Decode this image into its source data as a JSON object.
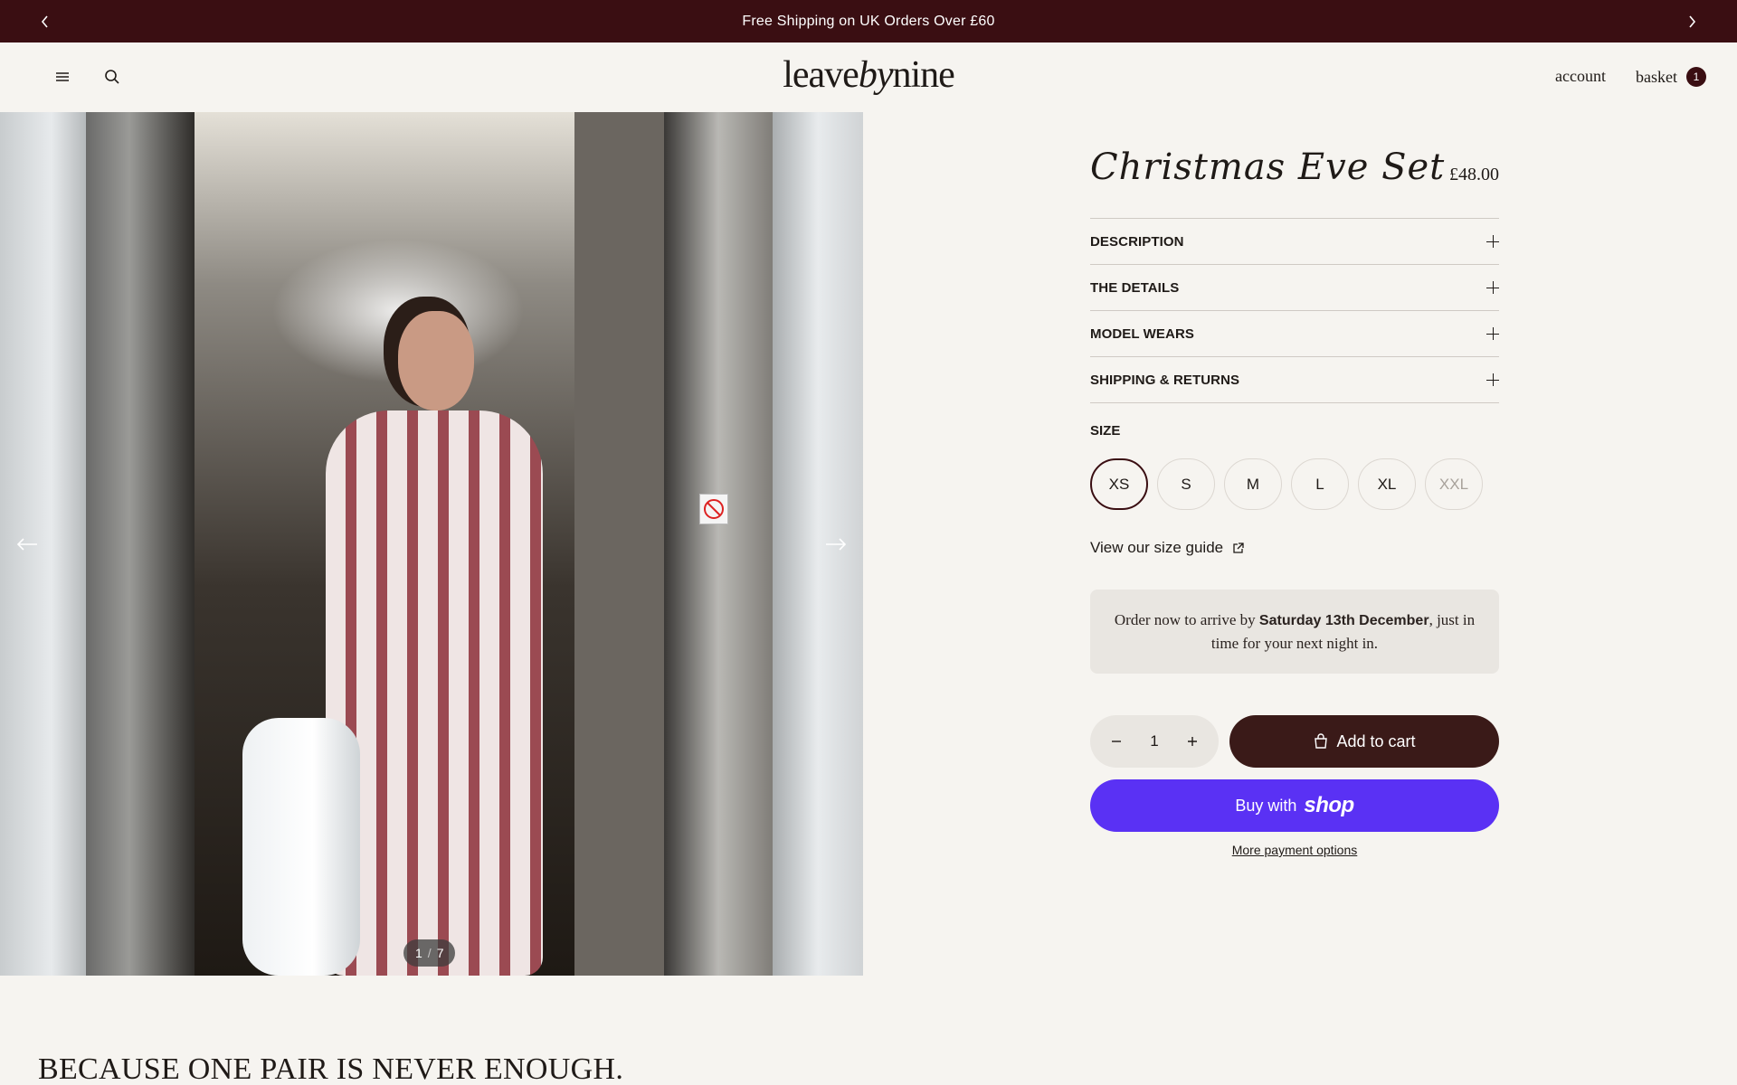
{
  "announcement": {
    "text": "Free Shipping on UK Orders Over £60"
  },
  "header": {
    "logo_part1": "leave",
    "logo_part2": "by",
    "logo_part3": "nine",
    "account_label": "account",
    "basket_label": "basket",
    "basket_count": "1"
  },
  "gallery": {
    "current": "1",
    "separator": "/",
    "total": "7"
  },
  "product": {
    "title": "Christmas Eve Set",
    "price": "£48.00",
    "accordions": [
      {
        "label": "DESCRIPTION"
      },
      {
        "label": "THE DETAILS"
      },
      {
        "label": "MODEL WEARS"
      },
      {
        "label": "SHIPPING & RETURNS"
      }
    ],
    "size_label": "SIZE",
    "sizes": [
      {
        "label": "XS",
        "selected": true,
        "available": true
      },
      {
        "label": "S",
        "selected": false,
        "available": true
      },
      {
        "label": "M",
        "selected": false,
        "available": true
      },
      {
        "label": "L",
        "selected": false,
        "available": true
      },
      {
        "label": "XL",
        "selected": false,
        "available": true
      },
      {
        "label": "XXL",
        "selected": false,
        "available": false
      }
    ],
    "size_guide": "View our size guide",
    "delivery": {
      "prefix": "Order now to arrive by ",
      "date": "Saturday 13th December",
      "suffix": ", just in time for your next night in."
    },
    "quantity": "1",
    "add_to_cart": "Add to cart",
    "buy_with": "Buy with",
    "shop_brand": "shop",
    "more_payment": "More payment options"
  },
  "tagline": "BECAUSE ONE PAIR IS NEVER ENOUGH.",
  "colors": {
    "brand_dark": "#3a0e12",
    "shop_purple": "#5a31f4",
    "background": "#f6f4f0"
  }
}
